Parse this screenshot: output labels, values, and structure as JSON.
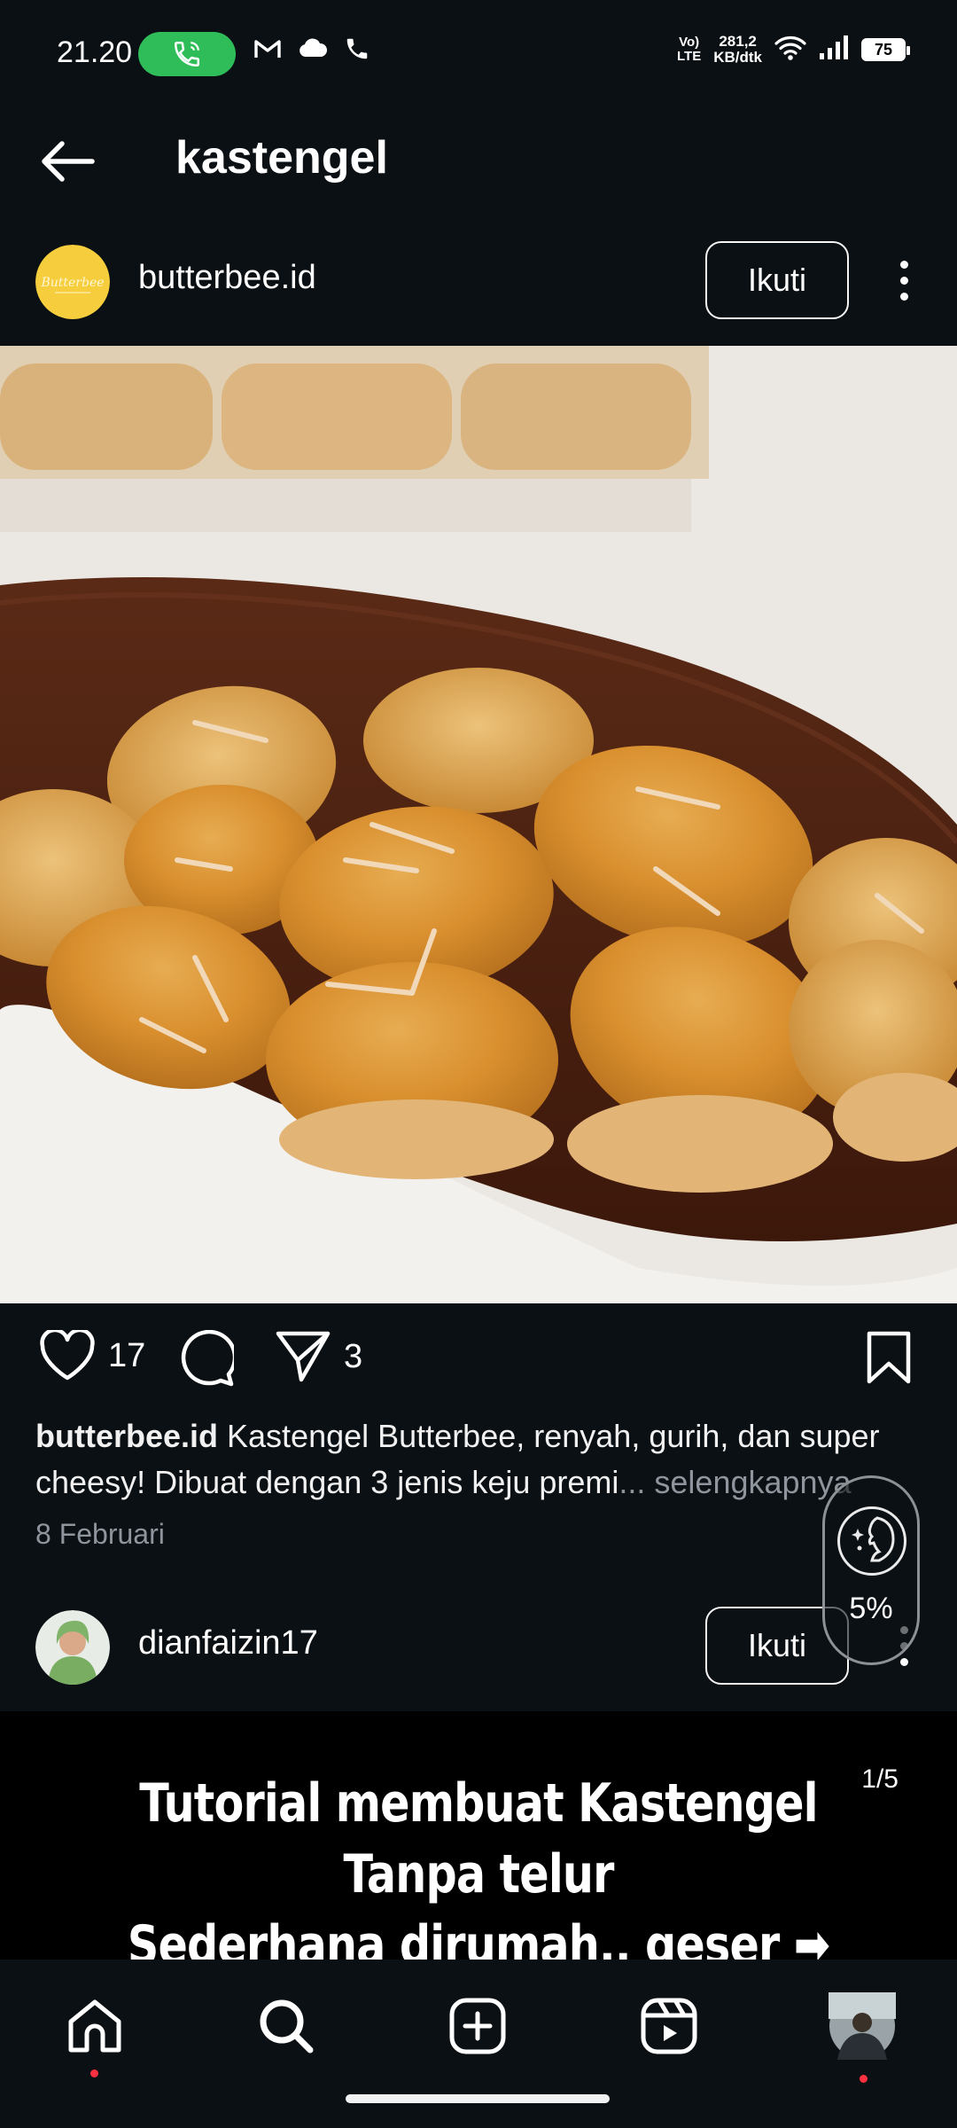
{
  "status_bar": {
    "time": "21.20",
    "volte": "Vo)\nLTE",
    "speed_value": "281,2",
    "speed_unit": "KB/dtk",
    "battery": "75",
    "icons": [
      "call-active-icon",
      "gmail-icon",
      "cloud-icon",
      "phone-icon",
      "wifi-icon",
      "signal-icon",
      "battery-icon"
    ]
  },
  "header": {
    "title": "kastengel",
    "back_icon": "arrow-left-icon"
  },
  "post": {
    "username": "butterbee.id",
    "follow_label": "Ikuti",
    "likes": "17",
    "shares": "3",
    "caption_user": "butterbee.id",
    "caption_text": " Kastengel Butterbee, renyah, gurih, dan super cheesy! Dibuat dengan 3 jenis keju premi",
    "caption_more": "... selengkapnya",
    "date": "8 Februari"
  },
  "float_widget": {
    "percent": "5%"
  },
  "next_post": {
    "username": "dianfaizin17",
    "follow_label": "Ikuti",
    "image_text_line1": "Tutorial membuat Kastengel Tanpa telur",
    "image_text_line2": "Sederhana dirumah.. geser ➡",
    "counter": "1/5"
  },
  "bottom_nav": {
    "items": [
      "home-icon",
      "search-icon",
      "create-icon",
      "reels-icon",
      "profile-avatar"
    ]
  },
  "colors": {
    "background": "#0b1014",
    "call_pill": "#2fbd5a",
    "muted_text": "#8e959c",
    "notification_dot": "#ff3040",
    "avatar_brand": "#f6cd3c"
  }
}
